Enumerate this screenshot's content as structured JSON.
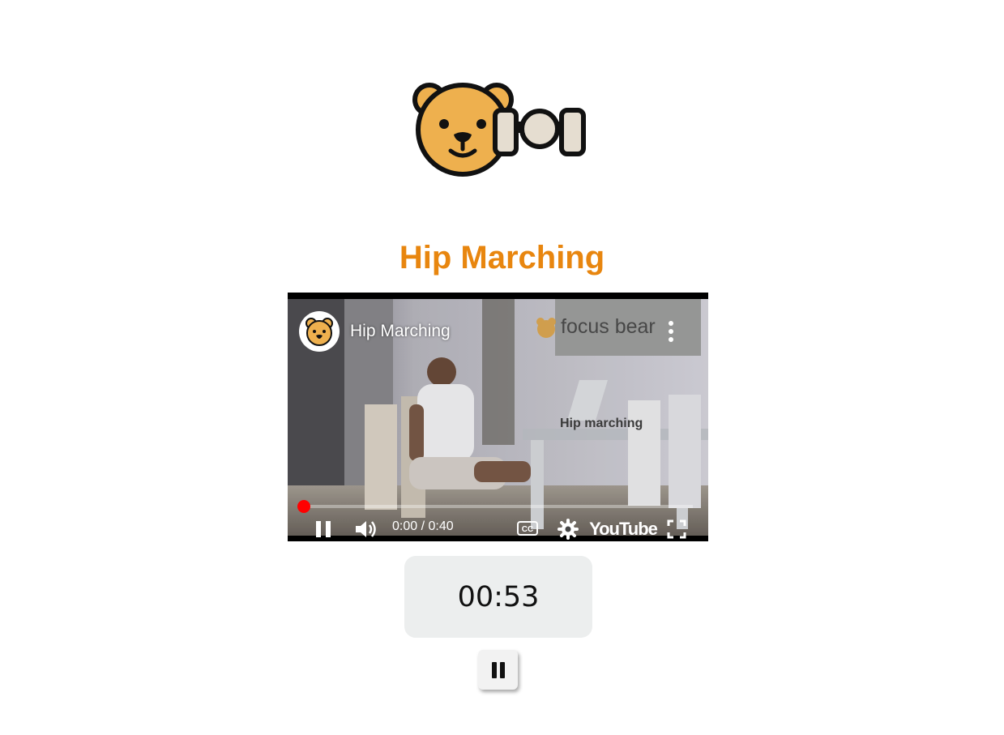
{
  "page": {
    "exercise_title": "Hip Marching",
    "timer": "00:53"
  },
  "video": {
    "title": "Hip Marching",
    "channel_watermark": "focus bear",
    "overlay_caption": "Hip marching",
    "time_display": "0:00 / 0:40",
    "progress": 0,
    "brand": "YouTube"
  },
  "icons": {
    "logo": "focus-bear-dumbbell-logo",
    "pause": "pause-icon",
    "volume": "volume-icon",
    "captions": "captions-icon",
    "settings": "gear-icon",
    "fullscreen": "fullscreen-icon",
    "more": "more-vert-icon"
  },
  "colors": {
    "title": "#e8860f",
    "bear": "#eeb04e",
    "progress": "#ff0000",
    "timer_bg": "#eceeee"
  }
}
